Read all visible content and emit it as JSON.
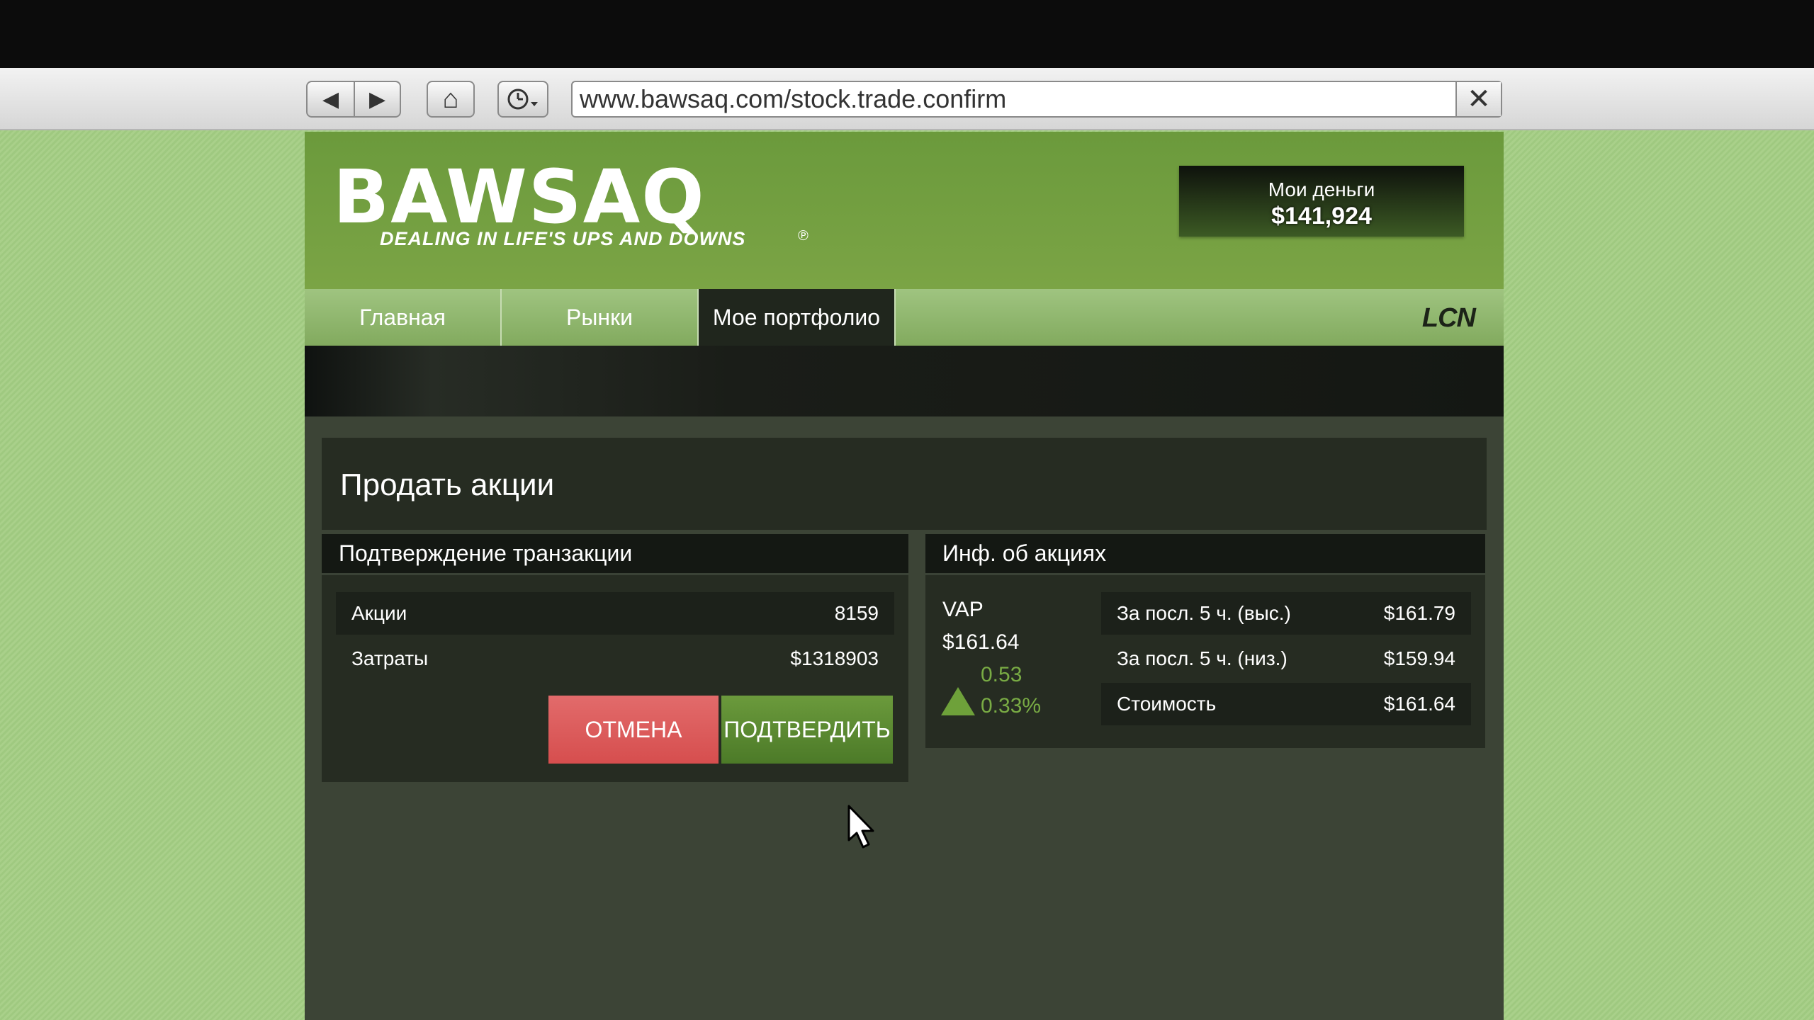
{
  "browser": {
    "url": "www.bawsaq.com/stock.trade.confirm",
    "back_icon": "◀",
    "forward_icon": "▶",
    "home_icon": "⌂",
    "history_icon": "🕒",
    "close_icon": "✕"
  },
  "header": {
    "logo": "BAWSAQ",
    "tagline": "DEALING IN LIFE'S UPS AND DOWNS",
    "mark": "℗",
    "money_label": "Мои деньги",
    "money_value": "$141,924"
  },
  "tabs": [
    {
      "label": "Главная"
    },
    {
      "label": "Рынки"
    },
    {
      "label": "Мое портфолио"
    }
  ],
  "lcn": "LCN",
  "page_title": "Продать акции",
  "transaction": {
    "title": "Подтверждение транзакции",
    "rows": [
      {
        "label": "Акции",
        "value": "8159"
      },
      {
        "label": "Затраты",
        "value": "$1318903"
      }
    ],
    "cancel_label": "ОТМЕНА",
    "confirm_label": "ПОДТВЕРДИТЬ"
  },
  "stock": {
    "title": "Инф. об акциях",
    "ticker": "VAP",
    "price": "$161.64",
    "change": "0.53",
    "change_pct": "0.33%",
    "rows": [
      {
        "label": "За посл. 5 ч. (выс.)",
        "value": "$161.79"
      },
      {
        "label": "За посл. 5 ч. (низ.)",
        "value": "$159.94"
      },
      {
        "label": "Стоимость",
        "value": "$161.64"
      }
    ]
  },
  "colors": {
    "accent_green": "#6b9a3c",
    "cancel_red": "#d64e4e",
    "up_green": "#79ab44"
  }
}
